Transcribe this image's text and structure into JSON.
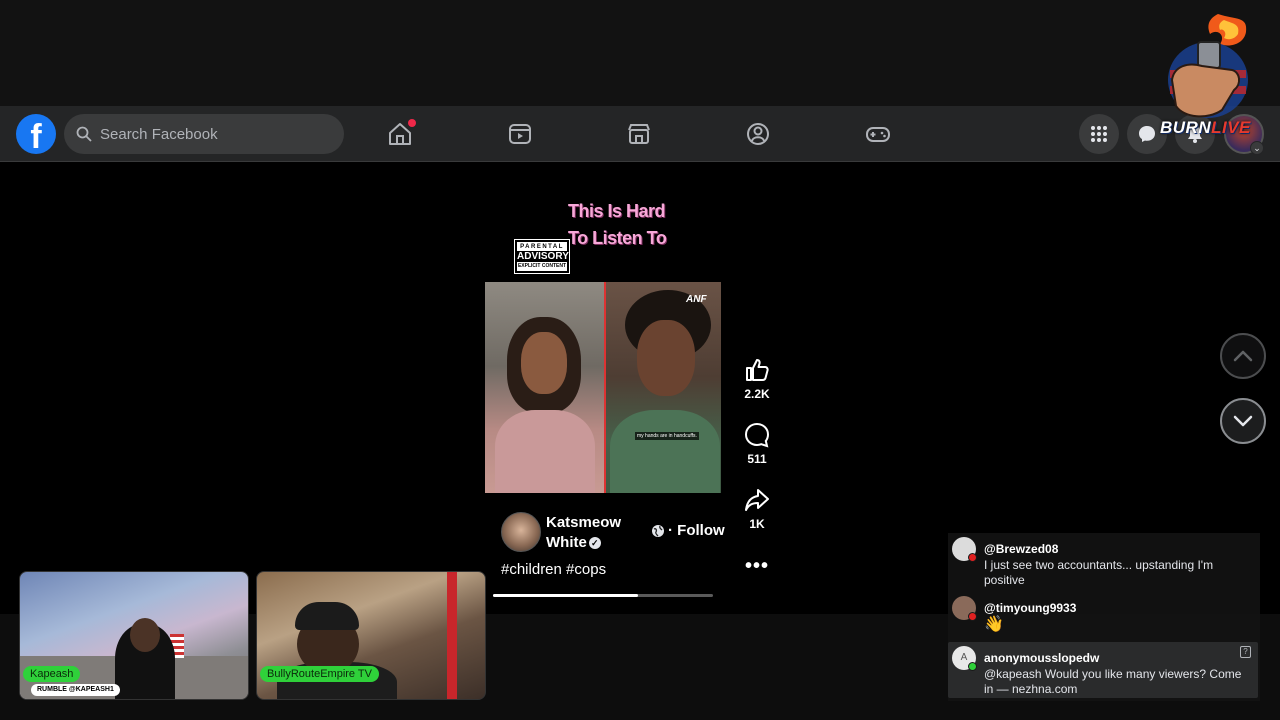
{
  "facebook": {
    "logo_letter": "f",
    "search_placeholder": "Search Facebook",
    "nav_items": [
      "home-icon",
      "video-icon",
      "marketplace-icon",
      "groups-icon",
      "gaming-icon"
    ],
    "right_items": [
      "menu-grid-icon",
      "messenger-icon",
      "notifications-icon",
      "account-avatar"
    ],
    "accent": "#1877f2"
  },
  "overlay": {
    "burn_logo_text": "BURN",
    "burn_logo_text_live": "LIVE",
    "title_line1": "This Is Hard",
    "title_line2": "To Listen To",
    "advisory_line1": "PARENTAL",
    "advisory_line2": "ADVISORY",
    "advisory_line3": "EXPLICIT CONTENT"
  },
  "reel": {
    "watermark": "ANF",
    "caption": "my hands are in handcuffs.",
    "poster_name": "Katsmeow White",
    "follow_label": "· Follow",
    "hashtags": "#children #cops",
    "progress": 0.66,
    "likes": "2.2K",
    "comments": "511",
    "shares": "1K"
  },
  "streams": [
    {
      "label": "Kapeash",
      "tag": "RUMBLE @KAPEASH1"
    },
    {
      "label": "BullyRouteEmpire TV"
    }
  ],
  "chat": [
    {
      "user": "@Brewzed08",
      "text": "I just see two accountants... upstanding I'm positive"
    },
    {
      "user": "@timyoung9933",
      "text": "👋"
    },
    {
      "user": "anonymousslopedw",
      "text": "@kapeash Would you like many viewers? Come in — nezhna.com"
    }
  ]
}
